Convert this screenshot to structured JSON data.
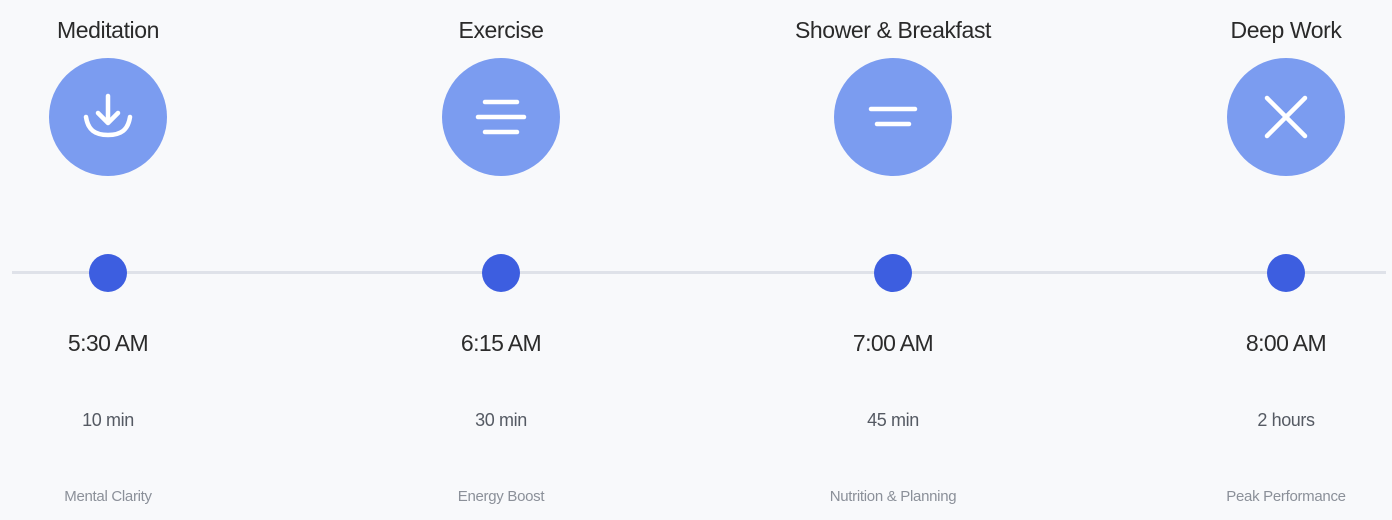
{
  "steps": [
    {
      "title": "Meditation",
      "icon": "download-arrow-icon",
      "time": "5:30 AM",
      "duration": "10 min",
      "benefit": "Mental Clarity"
    },
    {
      "title": "Exercise",
      "icon": "three-lines-icon",
      "time": "6:15 AM",
      "duration": "30 min",
      "benefit": "Energy Boost"
    },
    {
      "title": "Shower & Breakfast",
      "icon": "equals-icon",
      "time": "7:00 AM",
      "duration": "45 min",
      "benefit": "Nutrition & Planning"
    },
    {
      "title": "Deep Work",
      "icon": "close-x-icon",
      "time": "8:00 AM",
      "duration": "2 hours",
      "benefit": "Peak Performance"
    }
  ],
  "colors": {
    "icon_circle": "#7b9cf0",
    "dot": "#3d5ee0",
    "line": "#dfe2e9",
    "background": "#f8f9fb"
  }
}
